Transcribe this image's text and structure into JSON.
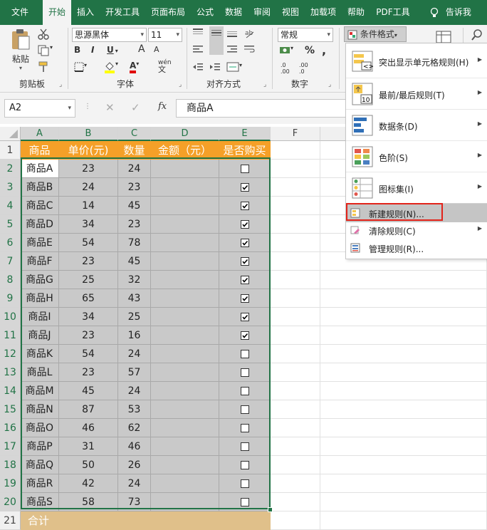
{
  "ribbon_tabs": [
    "文件",
    "开始",
    "插入",
    "开发工具",
    "页面布局",
    "公式",
    "数据",
    "审阅",
    "视图",
    "加载项",
    "帮助",
    "PDF工具"
  ],
  "tell_me": "告诉我",
  "clipboard": {
    "paste_label": "粘贴",
    "group_label": "剪贴板"
  },
  "font": {
    "name": "思源黑体",
    "size": "11",
    "group_label": "字体",
    "bold": "B",
    "italic": "I",
    "underline": "U",
    "grow": "A",
    "shrink": "A",
    "wen": "wén",
    "fill_glyph": "A",
    "color_glyph": "A"
  },
  "alignment": {
    "group_label": "对齐方式"
  },
  "number": {
    "format": "常规",
    "group_label": "数字",
    "percent": "%",
    "comma": ",",
    "inc": ".0",
    "dec": ".00"
  },
  "cond_format_button": "条件格式",
  "name_box": "A2",
  "formula": "商品A",
  "fx": "fx",
  "columns": [
    "A",
    "B",
    "C",
    "D",
    "E",
    "F"
  ],
  "rows": [
    "1",
    "2",
    "3",
    "4",
    "5",
    "6",
    "7",
    "8",
    "9",
    "10",
    "11",
    "12",
    "13",
    "14",
    "15",
    "16",
    "17",
    "18",
    "19",
    "20",
    "21"
  ],
  "headers": [
    "商品",
    "单价(元)",
    "数量",
    "金额（元）",
    "是否购买"
  ],
  "table": [
    {
      "name": "商品A",
      "price": "23",
      "qty": "24",
      "buy": false
    },
    {
      "name": "商品B",
      "price": "24",
      "qty": "23",
      "buy": true
    },
    {
      "name": "商品C",
      "price": "14",
      "qty": "45",
      "buy": true
    },
    {
      "name": "商品D",
      "price": "34",
      "qty": "23",
      "buy": true
    },
    {
      "name": "商品E",
      "price": "54",
      "qty": "78",
      "buy": true
    },
    {
      "name": "商品F",
      "price": "23",
      "qty": "45",
      "buy": true
    },
    {
      "name": "商品G",
      "price": "25",
      "qty": "32",
      "buy": true
    },
    {
      "name": "商品H",
      "price": "65",
      "qty": "43",
      "buy": true
    },
    {
      "name": "商品I",
      "price": "34",
      "qty": "25",
      "buy": true
    },
    {
      "name": "商品J",
      "price": "23",
      "qty": "16",
      "buy": true
    },
    {
      "name": "商品K",
      "price": "54",
      "qty": "24",
      "buy": false
    },
    {
      "name": "商品L",
      "price": "23",
      "qty": "57",
      "buy": false
    },
    {
      "name": "商品M",
      "price": "45",
      "qty": "24",
      "buy": false
    },
    {
      "name": "商品N",
      "price": "87",
      "qty": "53",
      "buy": false
    },
    {
      "name": "商品O",
      "price": "46",
      "qty": "62",
      "buy": false
    },
    {
      "name": "商品P",
      "price": "31",
      "qty": "46",
      "buy": false
    },
    {
      "name": "商品Q",
      "price": "50",
      "qty": "26",
      "buy": false
    },
    {
      "name": "商品R",
      "price": "42",
      "qty": "24",
      "buy": false
    },
    {
      "name": "商品S",
      "price": "58",
      "qty": "73",
      "buy": false
    }
  ],
  "total_label": "合计",
  "menu": {
    "items": [
      {
        "label": "突出显示单元格规则(H)",
        "icon": "highlight-rules-icon",
        "submenu": true
      },
      {
        "label": "最前/最后规则(T)",
        "icon": "top-bottom-rules-icon",
        "submenu": true
      },
      {
        "label": "数据条(D)",
        "icon": "data-bars-icon",
        "submenu": true
      },
      {
        "label": "色阶(S)",
        "icon": "color-scales-icon",
        "submenu": true
      },
      {
        "label": "图标集(I)",
        "icon": "icon-sets-icon",
        "submenu": true
      }
    ],
    "new_rule": "新建规则(N)...",
    "clear_rules": "清除规则(C)",
    "manage_rules": "管理规则(R)...",
    "top10": "10"
  },
  "colors": {
    "excel_green": "#217346",
    "header_orange": "#f5a028",
    "total_tan": "#e0c08a",
    "selection_gray": "#c9c9c9",
    "highlight_red": "#e2231a"
  }
}
